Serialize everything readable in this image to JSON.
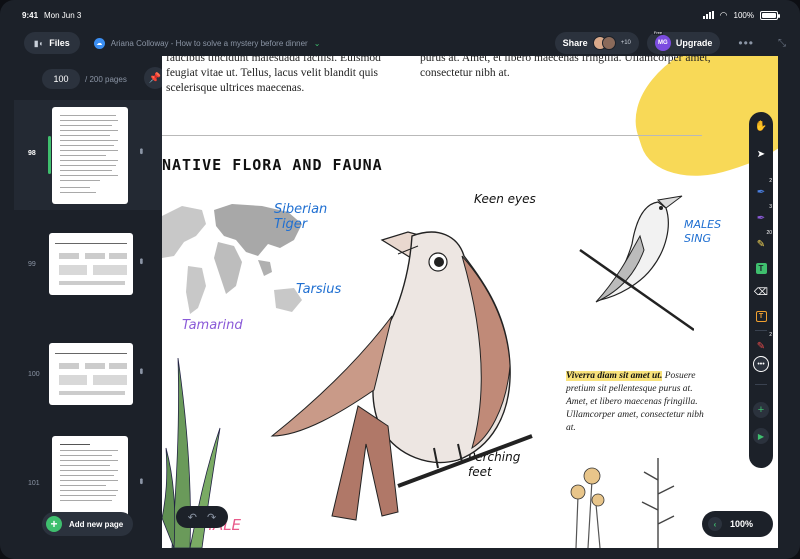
{
  "status_bar": {
    "time": "9:41",
    "date": "Mon Jun 3",
    "battery": "100%"
  },
  "toolbar": {
    "files_label": "Files",
    "doc_title": "Ariana Colloway - How to solve a mystery before dinner",
    "share_label": "Share",
    "collaborator_count": "+10",
    "upgrade_label": "Upgrade",
    "user_initials": "MG",
    "free_tag": "Free"
  },
  "sidebar": {
    "current_page": "100",
    "total_pages": "/ 200 pages",
    "thumbnails": [
      {
        "page": "98",
        "active": true
      },
      {
        "page": "99",
        "active": false
      },
      {
        "page": "100",
        "active": false
      },
      {
        "page": "101",
        "active": false
      }
    ],
    "add_page_label": "Add new page"
  },
  "page": {
    "text_left": "faucibus tincidunt malesuada facilisi. Euismod feugiat vitae ut. Tellus, lacus velit blandit quis scelerisque ultrices maecenas.",
    "text_right": "purus at. Amet, et libero maecenas fringilla. Ullamcorper amet, consectetur nibh at.",
    "section_title": "NATIVE FLORA AND FAUNA",
    "annotations": {
      "siberian_tiger": "Siberian Tiger",
      "tarsius": "Tarsius",
      "tamarind": "Tamarind",
      "keen_eyes": "Keen eyes",
      "males_sing": "MALES SING",
      "perching_feet": "Perching feet",
      "bottom_left": "MALE"
    },
    "caption_highlight": "Viverra diam sit amet ut.",
    "caption_rest": " Posuere pretium sit pellentesque purus at. Amet, et libero maecenas fringilla. Ullamcorper amet, consectetur nibh at."
  },
  "tools": {
    "pen1_badge": "2",
    "pen2_badge": "3",
    "highlighter_badge": "20",
    "laser_badge": "2"
  },
  "zoom": {
    "level": "100%"
  },
  "colors": {
    "accent_green": "#3fbf6e",
    "annotation_blue": "#1f6fd1",
    "highlight_yellow": "#f8d957",
    "panel": "#1c2129"
  }
}
